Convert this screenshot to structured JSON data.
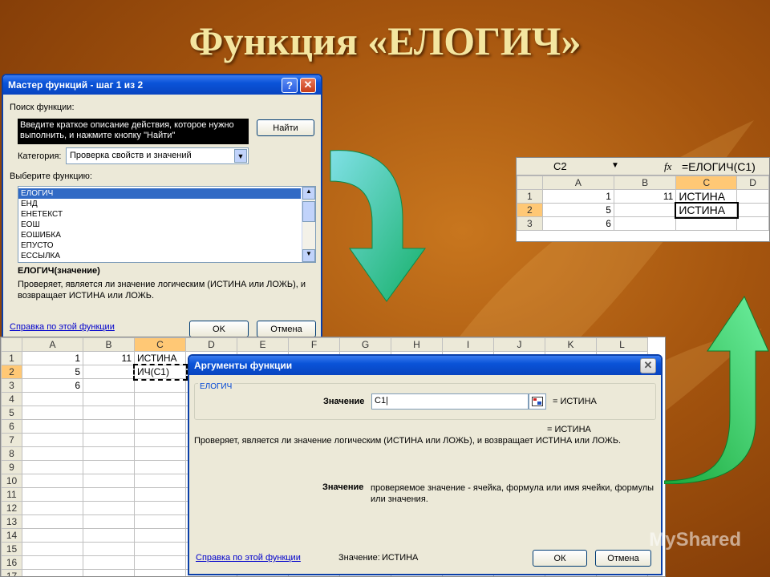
{
  "slide": {
    "title": "Функция «ЕЛОГИЧ»"
  },
  "wizard": {
    "title": "Мастер функций - шаг 1 из 2",
    "search_label": "Поиск функции:",
    "search_text": "Введите краткое описание действия, которое нужно выполнить, и нажмите кнопку \"Найти\"",
    "find_button": "Найти",
    "category_label": "Категория:",
    "category_value": "Проверка свойств и значений",
    "select_label": "Выберите функцию:",
    "functions": [
      "ЕЛОГИЧ",
      "ЕНД",
      "ЕНЕТЕКСТ",
      "ЕОШ",
      "ЕОШИБКА",
      "ЕПУСТО",
      "ЕССЫЛКА"
    ],
    "selected_function": "ЕЛОГИЧ",
    "signature": "ЕЛОГИЧ(значение)",
    "description": "Проверяет, является ли значение логическим (ИСТИНА или ЛОЖЬ), и возвращает ИСТИНА или ЛОЖЬ.",
    "help_link": "Справка по этой функции",
    "ok": "OK",
    "cancel": "Отмена"
  },
  "result_sheet": {
    "name_box": "C2",
    "fx": "fx",
    "formula": "=ЕЛОГИЧ(C1)",
    "columns": [
      "A",
      "B",
      "C",
      "D"
    ],
    "rows": [
      {
        "n": "1",
        "a": "1",
        "b": "11",
        "c": "ИСТИНА"
      },
      {
        "n": "2",
        "a": "5",
        "b": "",
        "c": "ИСТИНА"
      },
      {
        "n": "3",
        "a": "6",
        "b": "",
        "c": ""
      }
    ]
  },
  "big_sheet": {
    "columns": [
      "A",
      "B",
      "C",
      "D",
      "E",
      "F",
      "G",
      "H",
      "I",
      "J",
      "K",
      "L"
    ],
    "row_numbers": [
      "1",
      "2",
      "3",
      "4",
      "5",
      "6",
      "7",
      "8",
      "9",
      "10",
      "11",
      "12",
      "13",
      "14",
      "15",
      "16",
      "17"
    ],
    "cells": {
      "A1": "1",
      "B1": "11",
      "C1": "ИСТИНА",
      "A2": "5",
      "C2": "ИЧ(C1)",
      "A3": "6"
    }
  },
  "args": {
    "title": "Аргументы функции",
    "group": "ЕЛОГИЧ",
    "arg_label": "Значение",
    "arg_value": "C1",
    "arg_result": "= ИСТИНА",
    "func_result": "= ИСТИНА",
    "description": "Проверяет, является ли значение логическим (ИСТИНА или ЛОЖЬ), и возвращает ИСТИНА или ЛОЖЬ.",
    "param_name": "Значение",
    "param_desc": "проверяемое значение - ячейка, формула или имя ячейки, формулы или значения.",
    "help_link": "Справка по этой функции",
    "value_label": "Значение:",
    "value_result": "ИСТИНА",
    "ok": "ОК",
    "cancel": "Отмена"
  },
  "watermark": "MyShared"
}
